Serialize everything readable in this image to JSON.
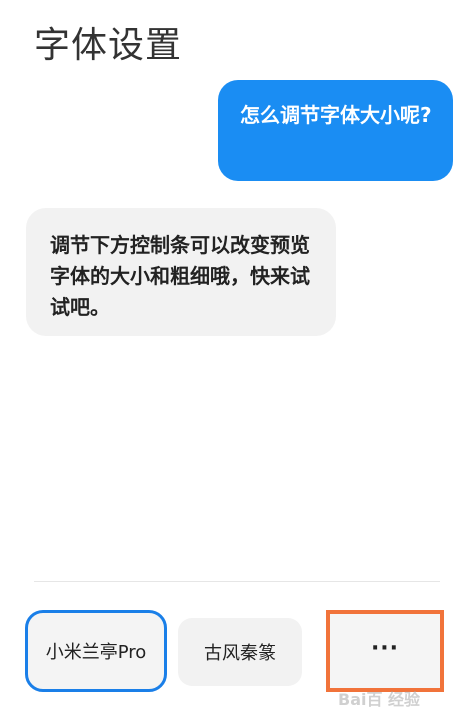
{
  "header": {
    "title": "字体设置"
  },
  "chat": {
    "user_message": "怎么调节字体大小呢?",
    "reply_message": "调节下方控制条可以改变预览字体的大小和粗细哦，快来试试吧。"
  },
  "font_options": [
    {
      "label": "小米兰亭Pro",
      "selected": true
    },
    {
      "label": "古风秦篆",
      "selected": false
    }
  ],
  "more": {
    "icon": "more-icon",
    "label": "···"
  },
  "watermark": {
    "text": "Bai百 经验"
  },
  "colors": {
    "accent": "#1a8df3",
    "selection_border": "#1a7fe8",
    "highlight_box": "#f1733a"
  }
}
